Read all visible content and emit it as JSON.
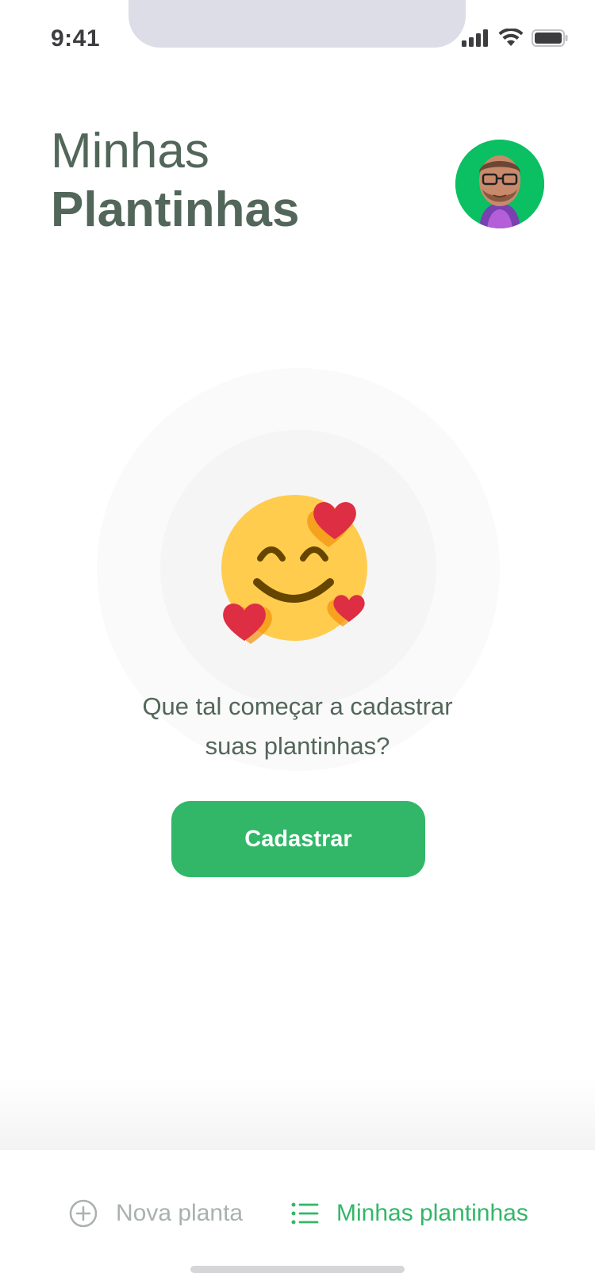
{
  "status_bar": {
    "time": "9:41",
    "icons": [
      "signal-icon",
      "wifi-icon",
      "battery-icon"
    ]
  },
  "header": {
    "title_light": "Minhas",
    "title_bold": "Plantinhas",
    "avatar": "avatar"
  },
  "empty_state": {
    "illustration": "smiling-face-with-hearts-icon",
    "line1": "Que tal começar a cadastrar",
    "line2": "suas plantinhas?",
    "button_label": "Cadastrar"
  },
  "tabs": [
    {
      "label": "Nova planta",
      "icon": "plus-circle-icon",
      "active": false
    },
    {
      "label": "Minhas plantinhas",
      "icon": "list-icon",
      "active": true
    }
  ],
  "colors": {
    "accent": "#32b768",
    "heading": "#52665a",
    "muted": "#aab1ad",
    "avatar_bg": "#0bbf63"
  }
}
